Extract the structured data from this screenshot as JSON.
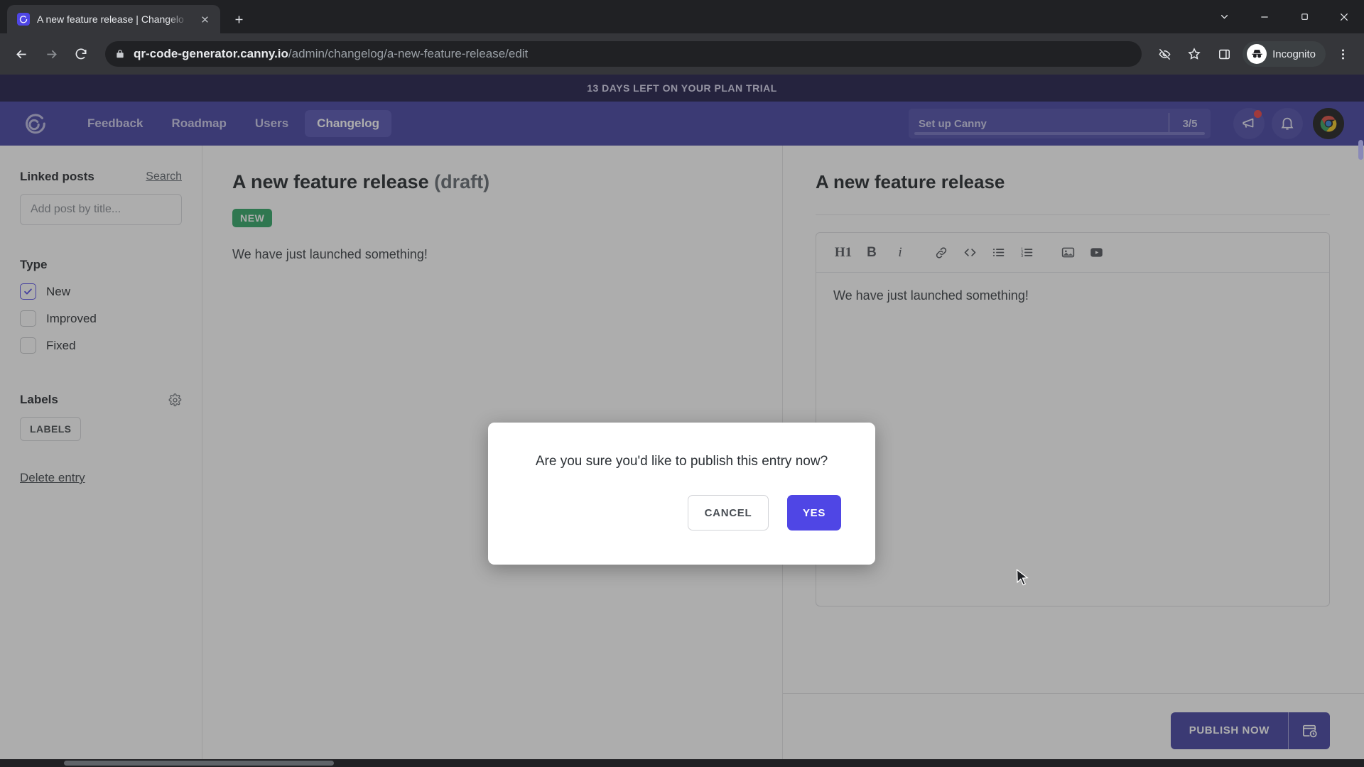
{
  "browser": {
    "tab": {
      "title": "A new feature release | Changelo",
      "favicon_icon": "canny-logo-icon",
      "close_icon": "close-icon"
    },
    "new_tab_icon": "plus-icon",
    "window_controls": {
      "chevron_icon": "chevron-down-icon",
      "minimize_icon": "minimize-icon",
      "maximize_icon": "maximize-icon",
      "close_icon": "close-icon"
    },
    "nav": {
      "back_icon": "arrow-back-icon",
      "forward_icon": "arrow-forward-icon",
      "reload_icon": "reload-icon"
    },
    "omnibox": {
      "lock_icon": "lock-icon",
      "url_domain": "qr-code-generator.canny.io",
      "url_path": "/admin/changelog/a-new-feature-release/edit"
    },
    "actions": {
      "tracking_icon": "eye-slash-icon",
      "bookmark_icon": "star-icon",
      "side_panel_icon": "side-panel-icon",
      "incognito_label": "Incognito",
      "incognito_icon": "incognito-hat-icon",
      "menu_icon": "three-dot-menu-icon"
    }
  },
  "trial_banner": {
    "text": "13 DAYS LEFT ON YOUR PLAN TRIAL"
  },
  "app_header": {
    "logo_icon": "canny-logo-icon",
    "nav_items": [
      {
        "label": "Feedback",
        "active": false
      },
      {
        "label": "Roadmap",
        "active": false
      },
      {
        "label": "Users",
        "active": false
      },
      {
        "label": "Changelog",
        "active": true
      }
    ],
    "setup_widget": {
      "label": "Set up Canny",
      "count": "3/5",
      "progress_percent": 60
    },
    "announcement_icon": "megaphone-icon",
    "notifications_icon": "bell-icon",
    "avatar_icon": "user-avatar"
  },
  "sidebar": {
    "linked_posts": {
      "heading": "Linked posts",
      "search_label": "Search",
      "input_placeholder": "Add post by title..."
    },
    "type": {
      "heading": "Type",
      "options": [
        {
          "label": "New",
          "checked": true
        },
        {
          "label": "Improved",
          "checked": false
        },
        {
          "label": "Fixed",
          "checked": false
        }
      ]
    },
    "labels": {
      "heading": "Labels",
      "settings_icon": "gear-icon",
      "chip_label": "LABELS"
    },
    "delete_entry_label": "Delete entry"
  },
  "preview": {
    "title_main": "A new feature release",
    "title_status": "(draft)",
    "badge": "NEW",
    "body": "We have just launched something!"
  },
  "editor": {
    "title": "A new feature release",
    "toolbar": [
      {
        "name": "heading-1-button",
        "glyph": "H1"
      },
      {
        "name": "bold-button",
        "glyph": "B"
      },
      {
        "name": "italic-button",
        "glyph": "i"
      },
      {
        "name": "link-button",
        "glyph": "link-icon"
      },
      {
        "name": "code-button",
        "glyph": "code-icon"
      },
      {
        "name": "bullet-list-button",
        "glyph": "bullet-list-icon"
      },
      {
        "name": "numbered-list-button",
        "glyph": "numbered-list-icon"
      },
      {
        "name": "image-button",
        "glyph": "image-icon"
      },
      {
        "name": "video-button",
        "glyph": "video-icon"
      }
    ],
    "content": "We have just launched something!",
    "publish_label": "PUBLISH NOW",
    "schedule_icon": "calendar-clock-icon"
  },
  "modal": {
    "message": "Are you sure you'd like to publish this entry now?",
    "cancel_label": "CANCEL",
    "confirm_label": "YES"
  },
  "colors": {
    "brand_purple": "#3b3a9e",
    "accent_indigo": "#4f46e5",
    "badge_green": "#27a35f",
    "banner_navy": "#161240"
  }
}
